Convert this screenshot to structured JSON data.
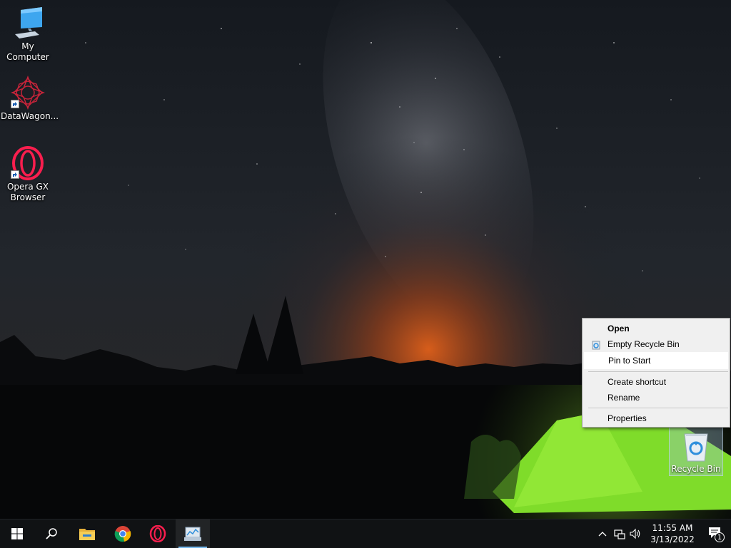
{
  "desktop": {
    "icons": [
      {
        "label": "My Computer",
        "icon": "monitor-icon"
      },
      {
        "label": "DataWagon...",
        "icon": "datawagon-icon"
      },
      {
        "label": "Opera GX Browser",
        "icon": "opera-gx-icon"
      }
    ],
    "recycle_bin": {
      "label": "Recycle Bin",
      "icon": "recycle-bin-icon"
    }
  },
  "context_menu": {
    "items": [
      {
        "label": "Open",
        "bold": true
      },
      {
        "label": "Empty Recycle Bin",
        "icon": "recycle-icon"
      },
      {
        "label": "Pin to Start",
        "highlighted": true
      },
      {
        "label": "Create shortcut"
      },
      {
        "label": "Rename"
      },
      {
        "label": "Properties"
      }
    ]
  },
  "taskbar": {
    "buttons": [
      {
        "name": "start-button",
        "icon": "windows-logo-icon"
      },
      {
        "name": "search-button",
        "icon": "search-icon"
      },
      {
        "name": "file-explorer",
        "icon": "folder-icon"
      },
      {
        "name": "chrome",
        "icon": "chrome-icon"
      },
      {
        "name": "opera",
        "icon": "opera-icon"
      },
      {
        "name": "control-panel",
        "icon": "control-panel-icon",
        "active": true
      }
    ],
    "tray": {
      "time": "11:55 AM",
      "date": "3/13/2022",
      "notification_count": "1",
      "icons": [
        "chevron-up-icon",
        "network-icon",
        "volume-icon",
        "action-center-icon"
      ]
    }
  },
  "colors": {
    "taskbar": "#101214",
    "menu_bg": "#f0f0f0",
    "accent": "#76b9ed",
    "tent_green": "#7fdc2a",
    "horizon_glow": "#e0601a"
  }
}
